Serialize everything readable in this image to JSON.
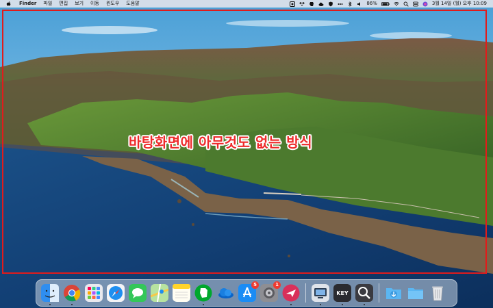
{
  "menubar": {
    "app_name": "Finder",
    "menus": [
      "파일",
      "편집",
      "보기",
      "이동",
      "윈도우",
      "도움말"
    ],
    "battery": "86%",
    "datetime": "3월 14일 (월) 오후 10:09",
    "status_icons": [
      "screen-record-icon",
      "dropbox-icon",
      "evernote-icon",
      "cloud-icon",
      "shield-icon",
      "dots-icon",
      "bluetooth-icon",
      "volume-icon",
      "battery-icon",
      "wifi-icon",
      "search-icon",
      "control-center-icon",
      "siri-icon"
    ]
  },
  "annotation": {
    "caption": "바탕화면에 아무것도 없는 방식",
    "color": "#e21b1b"
  },
  "dock": {
    "apps": [
      {
        "name": "Finder",
        "icon": "finder-icon",
        "running": true
      },
      {
        "name": "Chrome",
        "icon": "chrome-icon",
        "running": true
      },
      {
        "name": "Launchpad",
        "icon": "launchpad-icon",
        "running": false
      },
      {
        "name": "Safari",
        "icon": "safari-icon",
        "running": false
      },
      {
        "name": "Messages",
        "icon": "messages-icon",
        "running": false
      },
      {
        "name": "Maps",
        "icon": "maps-icon",
        "running": false
      },
      {
        "name": "Notes",
        "icon": "notes-icon",
        "running": false
      },
      {
        "name": "Evernote",
        "icon": "evernote-icon",
        "running": true
      },
      {
        "name": "OneDrive",
        "icon": "onedrive-icon",
        "running": false
      },
      {
        "name": "App Store",
        "icon": "app-store-icon",
        "running": false,
        "badge": "5"
      },
      {
        "name": "System Preferences",
        "icon": "system-preferences-icon",
        "running": false,
        "badge": "1"
      },
      {
        "name": "Airmail",
        "icon": "airmail-icon",
        "running": true
      },
      {
        "name": "Screenshot",
        "icon": "screenshot-icon",
        "running": true
      },
      {
        "name": "Keynote",
        "icon": "keynote-icon",
        "running": true,
        "label": "KEY"
      },
      {
        "name": "Preview",
        "icon": "magnifier-icon",
        "running": true
      }
    ],
    "folders": [
      {
        "name": "Downloads",
        "icon": "downloads-folder-icon"
      },
      {
        "name": "Folder",
        "icon": "folder-icon"
      },
      {
        "name": "Trash",
        "icon": "trash-icon"
      }
    ]
  }
}
